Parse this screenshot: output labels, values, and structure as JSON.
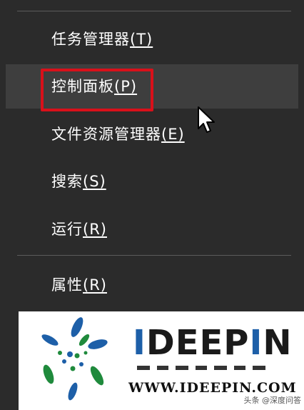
{
  "menu": {
    "items": [
      {
        "label": "任务管理器",
        "mnemonic": "(T)"
      },
      {
        "label": "控制面板",
        "mnemonic": "(P)"
      },
      {
        "label": "文件资源管理器",
        "mnemonic": "(E)"
      },
      {
        "label": "搜索",
        "mnemonic": "(S)"
      },
      {
        "label": "运行",
        "mnemonic": "(R)"
      },
      {
        "label": "属性",
        "mnemonic": "(R)"
      }
    ]
  },
  "logo": {
    "brand": "IDEEPIN",
    "url": "WWW.IDEEPIN.COM"
  },
  "watermark": "头条 @深度问答",
  "colors": {
    "menu_bg": "#2b2b2b",
    "hover_bg": "#3e3e3e",
    "highlight": "#d9101a",
    "brand_blue": "#1d5fa8",
    "brand_green": "#1f8a3c"
  }
}
